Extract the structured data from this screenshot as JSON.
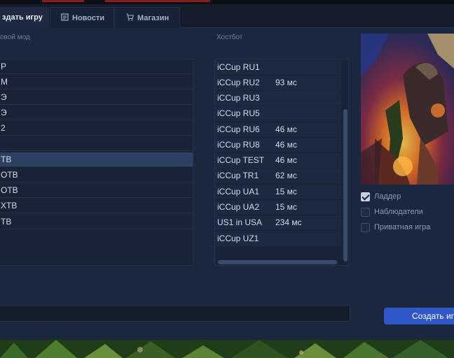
{
  "tabs": [
    {
      "label": "здать игру",
      "icon": "game-icon",
      "active": true
    },
    {
      "label": "Новости",
      "icon": "news-icon",
      "active": false
    },
    {
      "label": "Магазин",
      "icon": "cart-icon",
      "active": false
    }
  ],
  "left_section": {
    "label": "овой мод"
  },
  "modes": [
    {
      "label": "Р"
    },
    {
      "label": "М"
    },
    {
      "label": "Э"
    },
    {
      "label": "Э"
    },
    {
      "label": "2"
    },
    {
      "label": ""
    },
    {
      "label": "ТВ",
      "selected": true
    },
    {
      "label": "ОТВ"
    },
    {
      "label": "ОТВ"
    },
    {
      "label": "ХТВ"
    },
    {
      "label": "ТВ"
    }
  ],
  "hostbot_section": {
    "label": "Хостбот"
  },
  "hostbots": [
    {
      "name": "iCCup RU1",
      "ping": ""
    },
    {
      "name": "iCCup RU2",
      "ping": "93 мс"
    },
    {
      "name": "iCCup RU3",
      "ping": ""
    },
    {
      "name": "iCCup RU5",
      "ping": ""
    },
    {
      "name": "iCCup RU6",
      "ping": "46 мс"
    },
    {
      "name": "iCCup RU8",
      "ping": "46 мс"
    },
    {
      "name": "iCCup TEST",
      "ping": "46 мс"
    },
    {
      "name": "iCCup TR1",
      "ping": "62 мс"
    },
    {
      "name": "iCCup UA1",
      "ping": "15 мс"
    },
    {
      "name": "iCCup UA2",
      "ping": "15 мс"
    },
    {
      "name": "US1 in USA",
      "ping": "234 мс"
    },
    {
      "name": "iCCup UZ1",
      "ping": ""
    }
  ],
  "options": [
    {
      "label": "Ладдер",
      "checked": true
    },
    {
      "label": "Наблюдатели",
      "checked": false
    },
    {
      "label": "Приватная игра",
      "checked": false
    }
  ],
  "game_name_input": {
    "value": ""
  },
  "create_button": {
    "label": "Создать игру"
  },
  "colors": {
    "accent": "#2f57c8",
    "panel": "#1b273d",
    "selected_row": "#2d4164"
  }
}
